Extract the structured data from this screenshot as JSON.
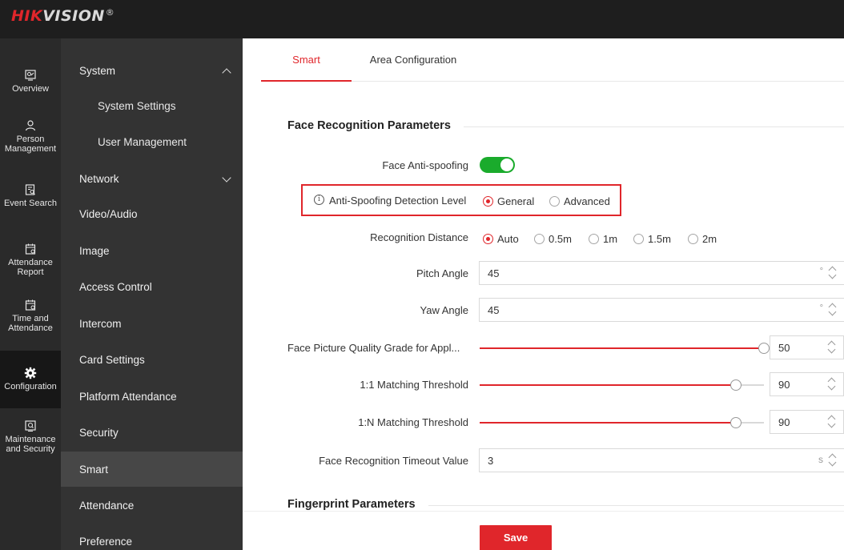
{
  "brand": {
    "name_red": "HIK",
    "name_white": "VISION",
    "reg": "®",
    "accent_color": "#e0262b"
  },
  "rail": [
    {
      "label": "Overview",
      "icon": "dashboard-icon"
    },
    {
      "label": "Person Management",
      "label_lines": [
        "Person",
        "Management"
      ],
      "icon": "person-icon"
    },
    {
      "label": "Event Search",
      "icon": "event-search-icon"
    },
    {
      "label": "Attendance Report",
      "label_lines": [
        "Attendance",
        "Report"
      ],
      "icon": "calendar-report-icon"
    },
    {
      "label": "Time and Attendance",
      "label_lines": [
        "Time and",
        "Attendance"
      ],
      "icon": "calendar-clock-icon"
    },
    {
      "label": "Configuration",
      "icon": "gear-icon",
      "active": true
    },
    {
      "label": "Maintenance and Security",
      "label_lines": [
        "Maintenance",
        "and Security"
      ],
      "icon": "maintenance-icon"
    }
  ],
  "submenu": [
    {
      "label": "System",
      "expanded": true
    },
    {
      "label": "System Settings",
      "child": true
    },
    {
      "label": "User Management",
      "child": true
    },
    {
      "label": "Network",
      "expanded": false
    },
    {
      "label": "Video/Audio"
    },
    {
      "label": "Image"
    },
    {
      "label": "Access Control"
    },
    {
      "label": "Intercom"
    },
    {
      "label": "Card Settings"
    },
    {
      "label": "Platform Attendance"
    },
    {
      "label": "Security"
    },
    {
      "label": "Smart",
      "active": true
    },
    {
      "label": "Attendance"
    },
    {
      "label": "Preference"
    }
  ],
  "tabs": [
    {
      "label": "Smart",
      "active": true
    },
    {
      "label": "Area Configuration"
    }
  ],
  "face_section": {
    "title": "Face Recognition Parameters",
    "anti_spoofing": {
      "label": "Face Anti-spoofing",
      "enabled": true
    },
    "detection_level": {
      "label": "Anti-Spoofing Detection Level",
      "options": [
        "General",
        "Advanced"
      ],
      "selected": "General"
    },
    "recognition_distance": {
      "label": "Recognition Distance",
      "options": [
        "Auto",
        "0.5m",
        "1m",
        "1.5m",
        "2m"
      ],
      "selected": "Auto"
    },
    "pitch_angle": {
      "label": "Pitch Angle",
      "value": "45",
      "unit": "°"
    },
    "yaw_angle": {
      "label": "Yaw Angle",
      "value": "45",
      "unit": "°"
    },
    "quality_grade": {
      "label": "Face Picture Quality Grade for Appl...",
      "value": "50",
      "fraction": 1.0
    },
    "match_1_1": {
      "label": "1:1 Matching Threshold",
      "value": "90",
      "fraction": 0.9
    },
    "match_1_n": {
      "label": "1:N Matching Threshold",
      "value": "90",
      "fraction": 0.9
    },
    "timeout": {
      "label": "Face Recognition Timeout Value",
      "value": "3",
      "unit": "s"
    }
  },
  "fingerprint_section": {
    "title": "Fingerprint Parameters"
  },
  "save_label": "Save"
}
